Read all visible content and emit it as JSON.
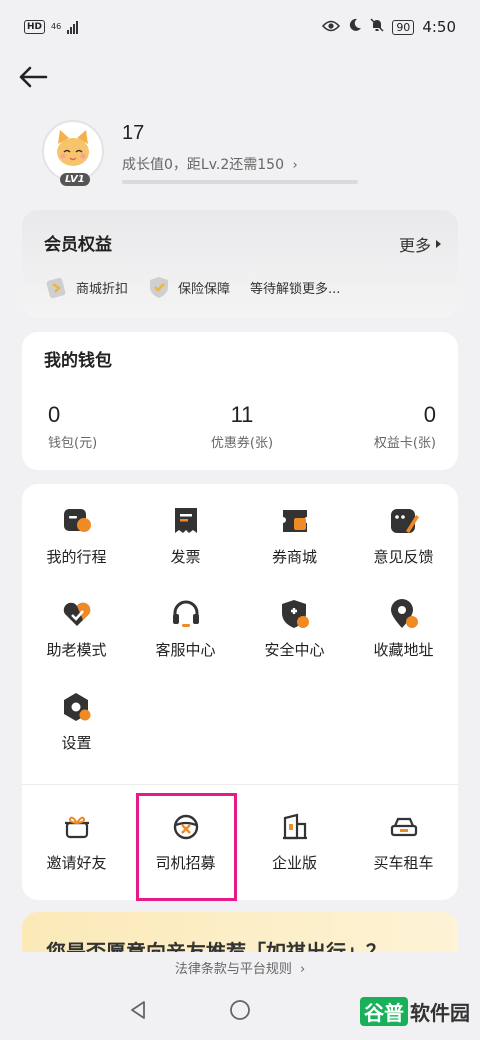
{
  "status_bar": {
    "network": "HD",
    "signal_label": "46",
    "battery": "90",
    "time": "4:50"
  },
  "profile": {
    "username": "17",
    "growth_text": "成长值0，距Lv.2还需150",
    "level": "LV1",
    "growth_progress": 0
  },
  "member": {
    "title": "会员权益",
    "more": "更多",
    "perks": [
      {
        "label": "商城折扣"
      },
      {
        "label": "保险保障"
      }
    ],
    "pending": "等待解锁更多..."
  },
  "wallet": {
    "title": "我的钱包",
    "items": [
      {
        "value": "0",
        "label": "钱包(元)"
      },
      {
        "value": "11",
        "label": "优惠券(张)"
      },
      {
        "value": "0",
        "label": "权益卡(张)"
      }
    ]
  },
  "services": [
    {
      "label": "我的行程",
      "icon": "trip-icon"
    },
    {
      "label": "发票",
      "icon": "invoice-icon"
    },
    {
      "label": "券商城",
      "icon": "coupon-mall-icon"
    },
    {
      "label": "意见反馈",
      "icon": "feedback-icon"
    },
    {
      "label": "助老模式",
      "icon": "elder-mode-icon"
    },
    {
      "label": "客服中心",
      "icon": "headset-icon"
    },
    {
      "label": "安全中心",
      "icon": "shield-icon"
    },
    {
      "label": "收藏地址",
      "icon": "location-icon"
    },
    {
      "label": "设置",
      "icon": "settings-icon"
    }
  ],
  "extras": [
    {
      "label": "邀请好友",
      "icon": "gift-icon"
    },
    {
      "label": "司机招募",
      "icon": "steering-wheel-icon"
    },
    {
      "label": "企业版",
      "icon": "building-icon"
    },
    {
      "label": "买车租车",
      "icon": "car-icon"
    }
  ],
  "promo": {
    "text": "您是否愿意向亲友推荐「如祺出行」？"
  },
  "legal": {
    "text": "法律条款与平台规则"
  },
  "watermark": {
    "part1": "谷普",
    "part2": "软件园"
  },
  "colors": {
    "accent": "#f08a24",
    "icon_dark": "#333333",
    "highlight": "#e8198b"
  }
}
